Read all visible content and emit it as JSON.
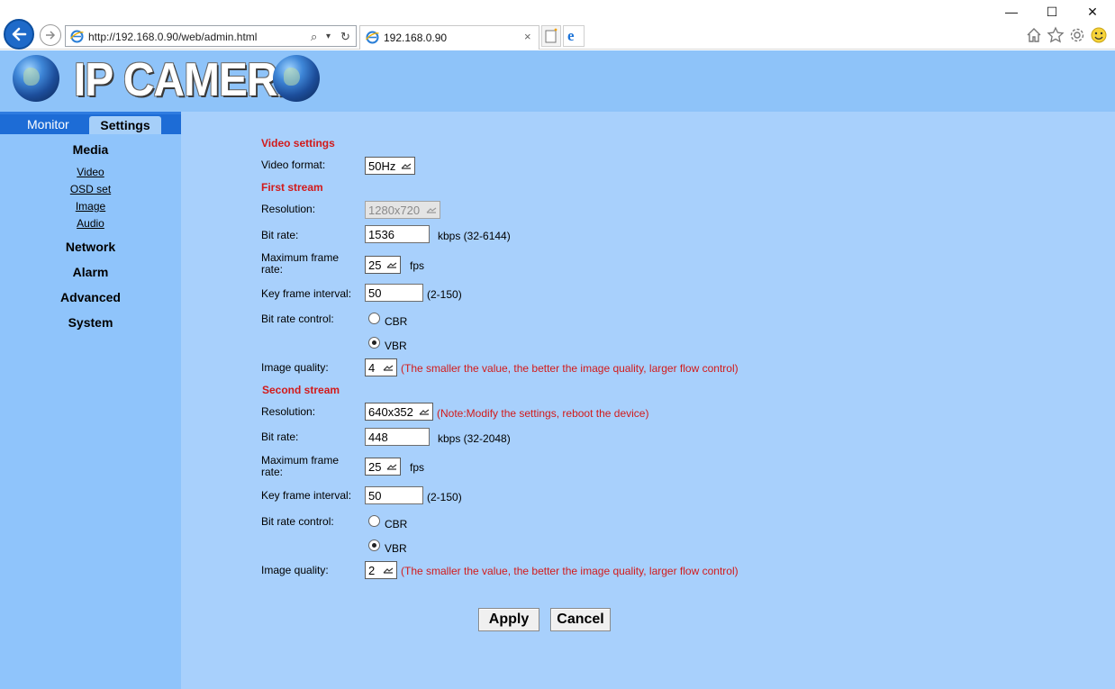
{
  "browser": {
    "url": "http://192.168.0.90/web/admin.html",
    "tab_title": "192.168.0.90",
    "url_controls": [
      "⌕",
      "▾",
      "↻"
    ],
    "tab_close": "×",
    "window_controls": [
      "—",
      "☐",
      "✕"
    ]
  },
  "brand": {
    "title": "IP CAMERA"
  },
  "tabs": {
    "monitor": "Monitor",
    "settings": "Settings"
  },
  "sidebar": {
    "media": "Media",
    "media_items": [
      "Video",
      "OSD set",
      "Image",
      "Audio"
    ],
    "network": "Network",
    "alarm": "Alarm",
    "advanced": "Advanced",
    "system": "System"
  },
  "video_settings": {
    "title": "Video settings",
    "format_label": "Video format:",
    "format_value": "50Hz"
  },
  "first_stream": {
    "title": "First stream",
    "resolution_label": "Resolution:",
    "resolution_value": "1280x720",
    "bitrate_label": "Bit rate:",
    "bitrate_value": "1536",
    "bitrate_hint": "kbps (32-6144)",
    "fps_label": "Maximum frame rate:",
    "fps_value": "25",
    "fps_unit": "fps",
    "keyframe_label": "Key frame interval:",
    "keyframe_value": "50",
    "keyframe_hint": "(2-150)",
    "control_label": "Bit rate control:",
    "cbr": "CBR",
    "vbr": "VBR",
    "control_selected": "VBR",
    "quality_label": "Image quality:",
    "quality_value": "4",
    "quality_note": "(The smaller the value, the better the image quality, larger flow control)"
  },
  "second_stream": {
    "title": "Second stream",
    "resolution_label": "Resolution:",
    "resolution_value": "640x352",
    "resolution_note": "(Note:Modify the settings, reboot the device)",
    "bitrate_label": "Bit rate:",
    "bitrate_value": "448",
    "bitrate_hint": "kbps (32-2048)",
    "fps_label": "Maximum frame rate:",
    "fps_value": "25",
    "fps_unit": "fps",
    "keyframe_label": "Key frame interval:",
    "keyframe_value": "50",
    "keyframe_hint": "(2-150)",
    "control_label": "Bit rate control:",
    "cbr": "CBR",
    "vbr": "VBR",
    "control_selected": "VBR",
    "quality_label": "Image quality:",
    "quality_value": "2",
    "quality_note": "(The smaller the value, the better the image quality, larger flow control)"
  },
  "actions": {
    "apply": "Apply",
    "cancel": "Cancel"
  },
  "colors": {
    "section_title": "#d21a1a",
    "page_bg": "#a8d0fc",
    "banner_bg": "#8ec3f9",
    "tab_bar": "#1d6cd6"
  }
}
